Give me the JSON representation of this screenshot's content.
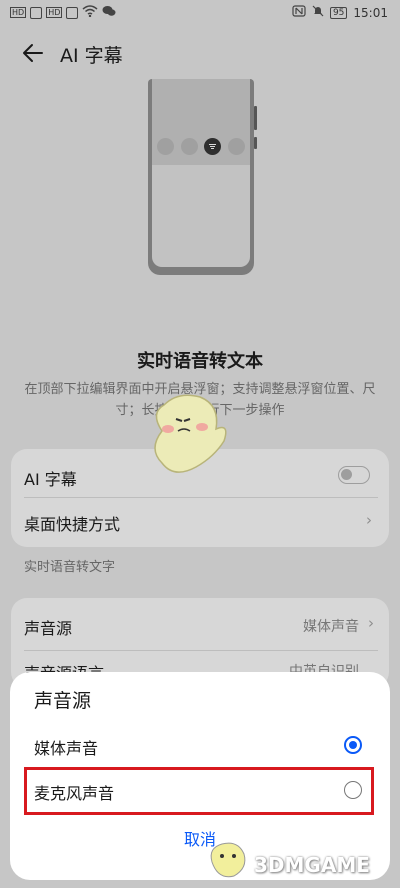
{
  "status_bar": {
    "left_glyphs": [
      "HD",
      "5G",
      "HD",
      "5G"
    ],
    "battery": "95",
    "time": "15:01"
  },
  "header": {
    "title": "AI 字幕"
  },
  "intro": {
    "title": "实时语音转文本",
    "description": "在顶部下拉编辑界面中开启悬浮窗；支持调整悬浮窗位置、尺寸；长按文本进行下一步操作"
  },
  "group1": {
    "items": [
      {
        "label": "AI 字幕",
        "control": "toggle",
        "toggle_on": false
      },
      {
        "label": "桌面快捷方式",
        "control": "chevron"
      }
    ]
  },
  "group2": {
    "header": "实时语音转文字",
    "items": [
      {
        "label": "声音源",
        "value": "媒体声音"
      },
      {
        "label": "声音源语言",
        "value": "中英自识别"
      }
    ]
  },
  "sheet": {
    "title": "声音源",
    "options": [
      {
        "label": "媒体声音",
        "selected": true
      },
      {
        "label": "麦克风声音",
        "selected": false
      }
    ],
    "cancel_label": "取消"
  },
  "watermark": {
    "text": "3DMGAME"
  },
  "colors": {
    "accent": "#0a59f7",
    "highlight_border": "#d8191f",
    "overlay_background": "#c6c6c6"
  }
}
